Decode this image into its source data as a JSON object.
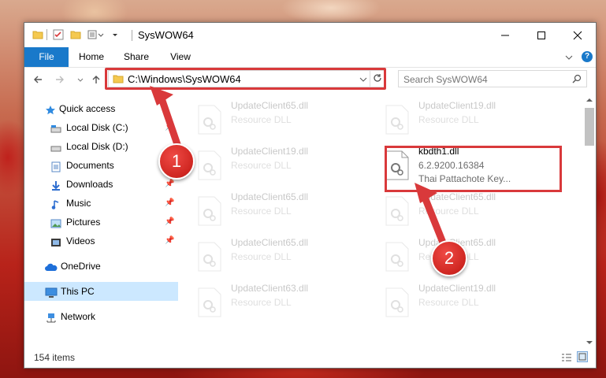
{
  "window": {
    "title": "SysWOW64",
    "controls": {
      "minimize": "—",
      "maximize": "☐",
      "close": "✕"
    }
  },
  "ribbon": {
    "tabs": [
      {
        "label": "File",
        "active": true
      },
      {
        "label": "Home"
      },
      {
        "label": "Share"
      },
      {
        "label": "View"
      }
    ]
  },
  "address": {
    "path": "C:\\Windows\\SysWOW64",
    "search_placeholder": "Search SysWOW64"
  },
  "nav": {
    "items": [
      {
        "label": "Quick access",
        "icon": "star-icon",
        "pinned": false
      },
      {
        "label": "Local Disk (C:)",
        "icon": "drive-icon",
        "pinned": true
      },
      {
        "label": "Local Disk (D:)",
        "icon": "drive-icon",
        "pinned": false
      },
      {
        "label": "Documents",
        "icon": "document-icon",
        "pinned": true
      },
      {
        "label": "Downloads",
        "icon": "download-icon",
        "pinned": true
      },
      {
        "label": "Music",
        "icon": "music-icon",
        "pinned": true
      },
      {
        "label": "Pictures",
        "icon": "picture-icon",
        "pinned": true
      },
      {
        "label": "Videos",
        "icon": "video-icon",
        "pinned": true
      },
      {
        "label": "OneDrive",
        "icon": "cloud-icon",
        "pinned": false
      },
      {
        "label": "This PC",
        "icon": "computer-icon",
        "pinned": false,
        "selected": true
      },
      {
        "label": "Network",
        "icon": "network-icon",
        "pinned": false
      }
    ]
  },
  "files": [
    {
      "name": "UpdateClient65.dll",
      "desc": "Resource DLL",
      "faded": true
    },
    {
      "name": "UpdateClient19.dll",
      "desc": "Resource DLL",
      "faded": true
    },
    {
      "name": "UpdateClient19.dll",
      "desc": "Resource DLL",
      "faded": true
    },
    {
      "name": "kbdth1.dll",
      "desc": "6.2.9200.16384",
      "desc2": "Thai Pattachote Key...",
      "faded": false,
      "highlighted": true
    },
    {
      "name": "UpdateClient65.dll",
      "desc": "Resource DLL",
      "faded": true
    },
    {
      "name": "UpdateClient65.dll",
      "desc": "Resource DLL",
      "faded": true
    },
    {
      "name": "UpdateClient65.dll",
      "desc": "Resource DLL",
      "faded": true
    },
    {
      "name": "UpdateClient65.dll",
      "desc": "Resource DLL",
      "faded": true
    },
    {
      "name": "UpdateClient63.dll",
      "desc": "Resource DLL",
      "faded": true
    },
    {
      "name": "UpdateClient19.dll",
      "desc": "Resource DLL",
      "faded": true
    }
  ],
  "status": {
    "item_count": "154 items"
  },
  "callouts": {
    "one": "1",
    "two": "2"
  },
  "colors": {
    "accent": "#1979ca",
    "highlight": "#d9393b",
    "selection": "#cce8ff"
  }
}
